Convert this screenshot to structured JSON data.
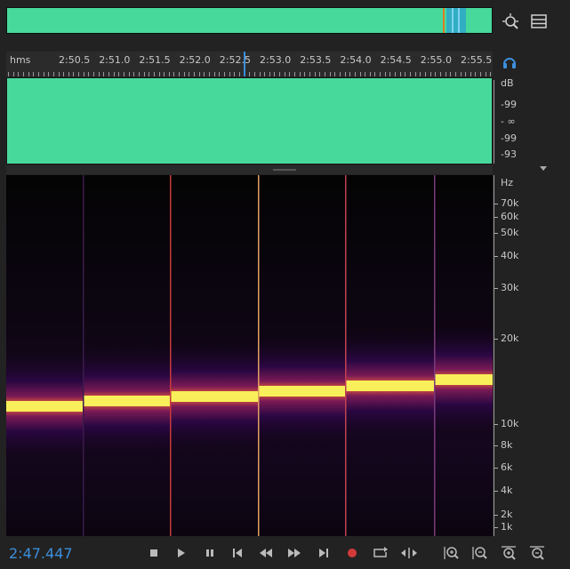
{
  "overview": {
    "colors": {
      "waveform": "#47d99c",
      "selection": "#2fa6c9",
      "playhead": "#e07a2a"
    }
  },
  "ruler": {
    "unit_label": "hms",
    "labels": [
      "2:50.5",
      "2:51.0",
      "2:51.5",
      "2:52.0",
      "2:52.5",
      "2:53.0",
      "2:53.5",
      "2:54.0",
      "2:54.5",
      "2:55.0",
      "2:55.5"
    ]
  },
  "amplitude_scale": {
    "unit": "dB",
    "labels": [
      "-99",
      "- ∞",
      "-99",
      "-93"
    ]
  },
  "frequency_scale": {
    "unit": "Hz",
    "labels": [
      "70k",
      "60k",
      "50k",
      "40k",
      "30k",
      "20k",
      "10k",
      "8k",
      "6k",
      "4k",
      "2k",
      "1k"
    ]
  },
  "transport": {
    "time": "2:47.447",
    "buttons": [
      "stop",
      "play",
      "pause",
      "go-to-start",
      "rewind",
      "fast-forward",
      "go-to-end",
      "record",
      "loop-playback",
      "skip-selection"
    ],
    "zoom_buttons": [
      "zoom-in-amplitude",
      "zoom-out-amplitude",
      "zoom-in-time",
      "zoom-out-time"
    ]
  },
  "colors": {
    "background": "#222222",
    "waveform": "#47d99c",
    "accent": "#3c8fdc",
    "spectrum_tone": "#f8ef5a",
    "record": "#d23a3a"
  }
}
